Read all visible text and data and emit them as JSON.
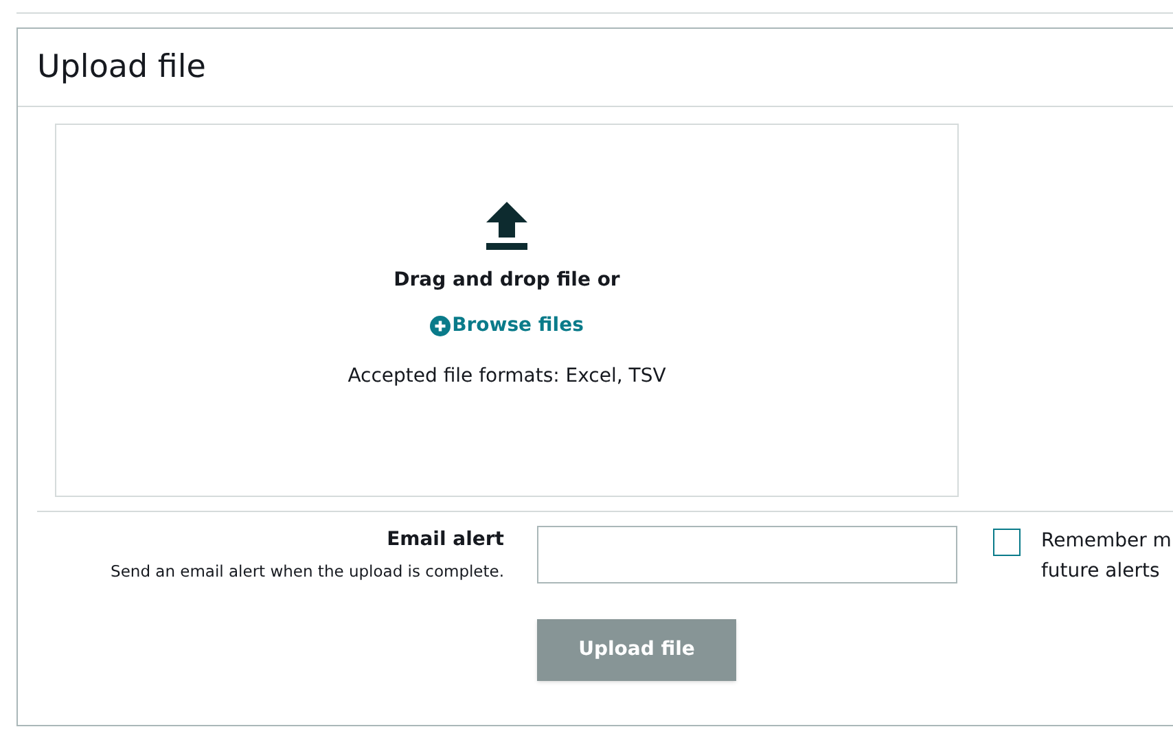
{
  "panel": {
    "title": "Upload file"
  },
  "dropzone": {
    "prompt": "Drag and drop file or",
    "browse_link": "Browse files",
    "formats": "Accepted file formats: Excel, TSV"
  },
  "email_alert": {
    "label": "Email alert",
    "description": "Send an email alert when the upload is complete."
  },
  "remember_checkbox": {
    "label_lines": [
      "Remember m",
      "future alerts"
    ],
    "checked": false
  },
  "submit_button": {
    "label": "Upload file",
    "disabled": true
  }
}
